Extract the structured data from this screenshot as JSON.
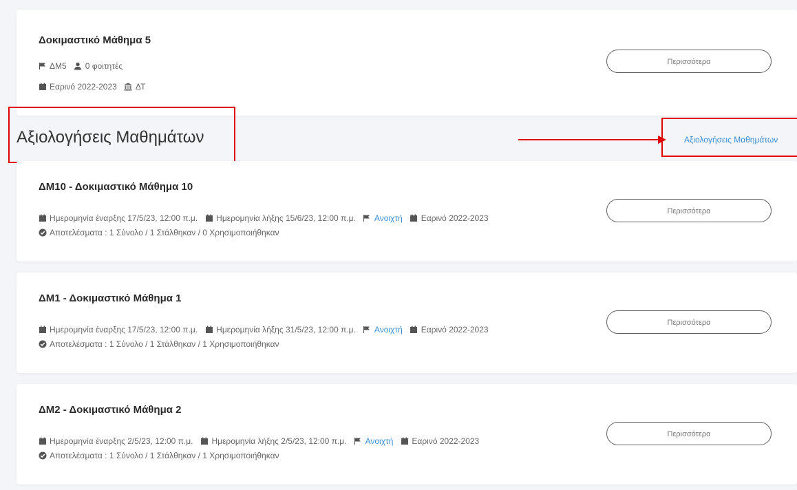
{
  "course_card": {
    "title": "Δοκιμαστικό Μάθημα 5",
    "code": "ΔΜ5",
    "students": "0 φοιτητές",
    "semester": "Εαρινό 2022-2023",
    "department": "ΔΤ",
    "more_label": "Περισσότερα"
  },
  "section": {
    "title": "Αξιολογήσεις Μαθημάτων",
    "link_label": "Αξιολογήσεις Μαθημάτων"
  },
  "evaluations": [
    {
      "title": "ΔΜ10 - Δοκιμαστικό Μάθημα 10",
      "start": "Ημερομηνία έναρξης 17/5/23, 12:00 π.μ.",
      "end": "Ημερομηνία λήξης 15/6/23, 12:00 π.μ.",
      "status": "Ανοιχτή",
      "semester": "Εαρινό 2022-2023",
      "results": "Αποτελέσματα : 1 Σύνολο / 1 Στάλθηκαν / 0 Χρησιμοποιήθηκαν",
      "more_label": "Περισσότερα"
    },
    {
      "title": "ΔΜ1 - Δοκιμαστικό Μάθημα 1",
      "start": "Ημερομηνία έναρξης 17/5/23, 12:00 π.μ.",
      "end": "Ημερομηνία λήξης 31/5/23, 12:00 π.μ.",
      "status": "Ανοιχτή",
      "semester": "Εαρινό 2022-2023",
      "results": "Αποτελέσματα : 1 Σύνολο / 1 Στάλθηκαν / 1 Χρησιμοποιήθηκαν",
      "more_label": "Περισσότερα"
    },
    {
      "title": "ΔΜ2 - Δοκιμαστικό Μάθημα 2",
      "start": "Ημερομηνία έναρξης 2/5/23, 12:00 π.μ.",
      "end": "Ημερομηνία λήξης 2/5/23, 12:00 π.μ.",
      "status": "Ανοιχτή",
      "semester": "Εαρινό 2022-2023",
      "results": "Αποτελέσματα : 1 Σύνολο / 1 Στάλθηκαν / 1 Χρησιμοποιήθηκαν",
      "more_label": "Περισσότερα"
    }
  ],
  "annotation_color": "#e10000",
  "accent_color": "#3a8fd6"
}
